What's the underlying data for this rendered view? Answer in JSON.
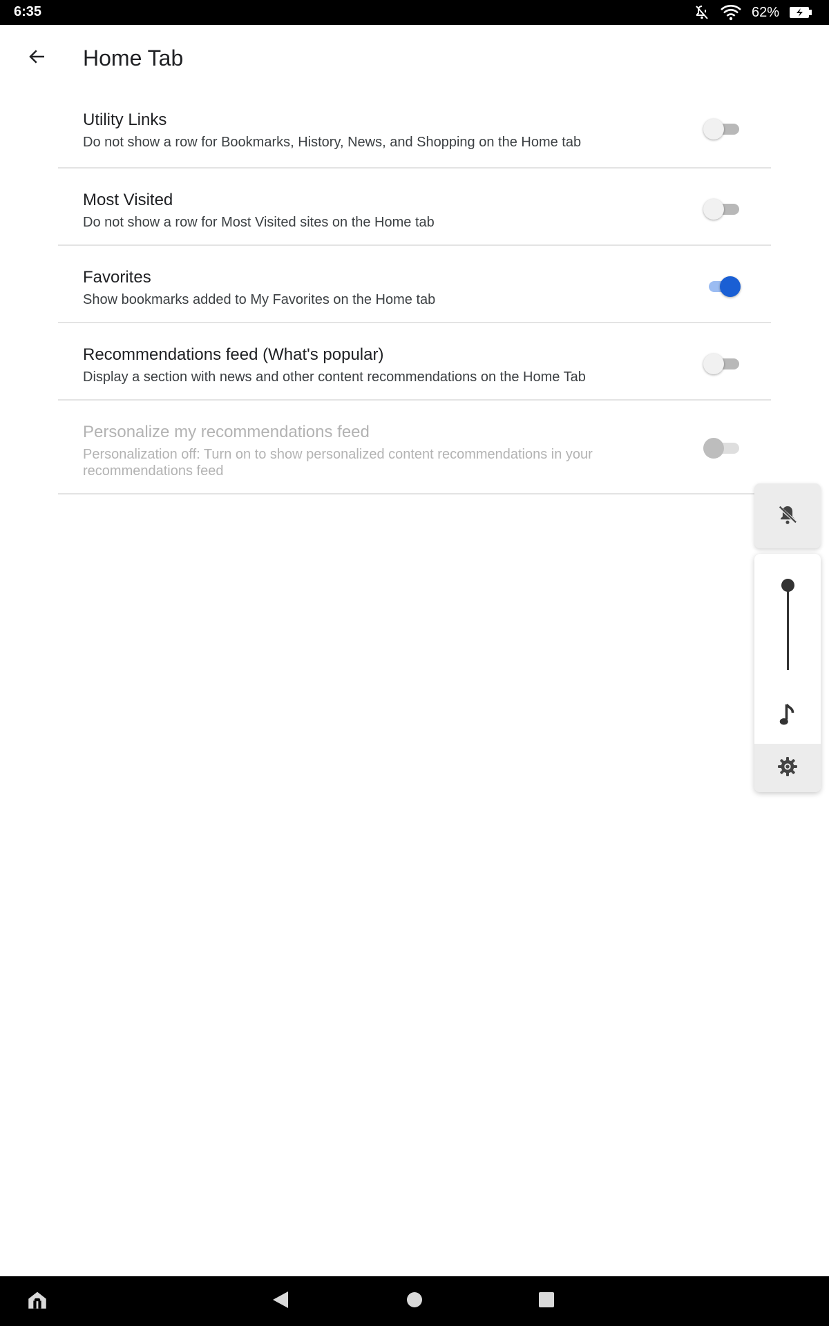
{
  "status_bar": {
    "time": "6:35",
    "battery": "62%",
    "icons": [
      "notifications-off-icon",
      "wifi-icon",
      "battery-charging-icon"
    ]
  },
  "app_bar": {
    "title": "Home Tab",
    "back_icon": "arrow-back-icon"
  },
  "settings": [
    {
      "title": "Utility Links",
      "description": "Do not show a row for Bookmarks, History, News, and Shopping on the Home tab",
      "enabled": false,
      "disabled": false
    },
    {
      "title": "Most Visited",
      "description": "Do not show a row for Most Visited sites on the Home tab",
      "enabled": false,
      "disabled": false
    },
    {
      "title": "Favorites",
      "description": "Show bookmarks added to My Favorites on the Home tab",
      "enabled": true,
      "disabled": false
    },
    {
      "title": "Recommendations feed (What's popular)",
      "description": "Display a section with news and other content recommendations on the Home Tab",
      "enabled": false,
      "disabled": false
    },
    {
      "title": "Personalize my recommendations feed",
      "description": "Personalization off: Turn on to show personalized content recommendations in your recommendations feed",
      "enabled": false,
      "disabled": true
    }
  ],
  "volume_panel": {
    "ringer_icon": "bell-off-icon",
    "media_icon": "music-note-icon",
    "settings_icon": "gear-icon",
    "level": 1.0
  },
  "nav_bar": {
    "icons": [
      "home-apps-icon",
      "back-triangle-icon",
      "home-circle-icon",
      "recents-square-icon"
    ]
  },
  "colors": {
    "accent": "#1a5fd4",
    "accent_track": "#9bbcf2",
    "divider": "#e3e3e3",
    "disabled_text": "#b3b3b3"
  }
}
